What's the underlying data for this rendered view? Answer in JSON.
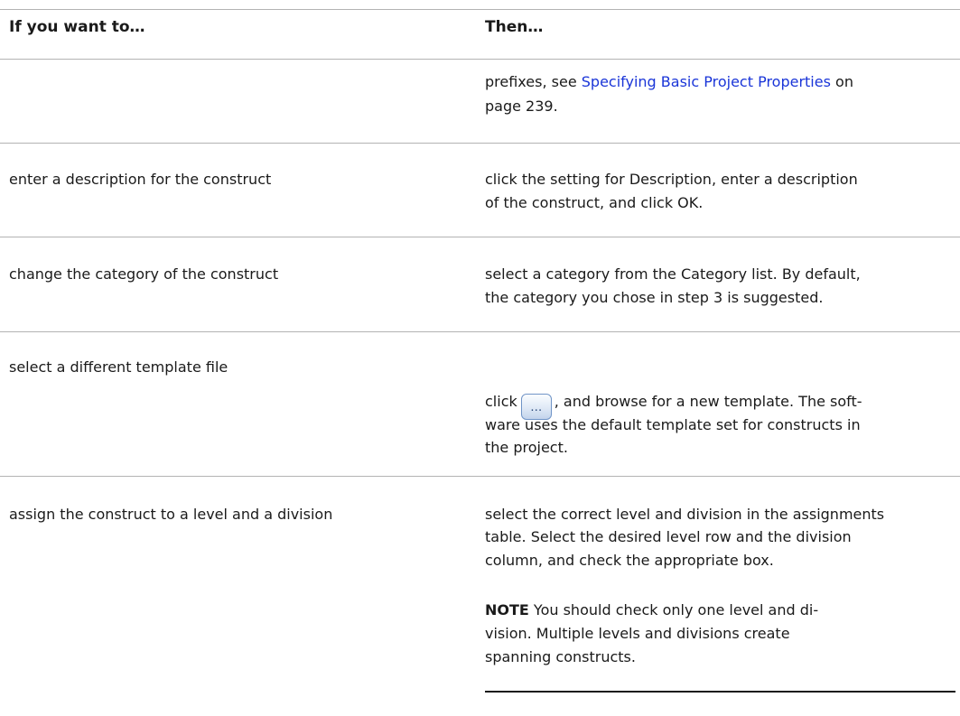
{
  "table": {
    "header": {
      "left": "If you want to…",
      "right": "Then…"
    },
    "row_prefixes": {
      "line1": {
        "before": "prefixes, see ",
        "link": "Specifying Basic Project Properties",
        "after": " on"
      },
      "line2": "page 239."
    },
    "row_description": {
      "left": "enter a description for the construct",
      "line1": "click the setting for Description, enter a description",
      "line2": "of the construct, and click OK."
    },
    "row_category": {
      "left": "change the category of the construct",
      "line1": "select a category from the Category list. By default,",
      "line2": "the category you chose in step 3 is suggested."
    },
    "row_template": {
      "left": "select a different template file",
      "line1_before": "click",
      "button_glyph": "…",
      "line1_after": ", and browse for a new template. The soft-",
      "line2": "ware uses the default template set for constructs in",
      "line3": "the project."
    },
    "row_assign": {
      "left": "assign the construct to a level and a division",
      "line1": "select the correct level and division in the assignments",
      "line2": "table. Select the desired level row and the division",
      "line3": "column, and check the appropriate box.",
      "note": {
        "label": "NOTE",
        "line1": " You should check only one level and di-",
        "line2": "vision. Multiple levels and divisions create",
        "line3": "spanning constructs."
      }
    }
  }
}
